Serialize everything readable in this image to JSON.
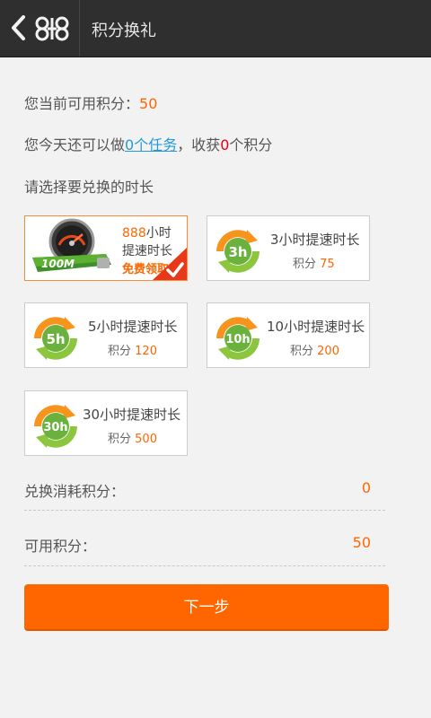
{
  "header": {
    "title": "积分换礼"
  },
  "info": {
    "points_label": "您当前可用积分：",
    "points_value": "50",
    "task_prefix": "您今天还可以做",
    "task_link": "0个任务",
    "task_middle": "，收获",
    "task_count": "0",
    "task_suffix": "个积分",
    "select_prompt": "请选择要兑换的时长"
  },
  "options": [
    {
      "icon": "speedometer-badge-icon",
      "badge": "100M",
      "line1_num": "888",
      "line1_unit": "小时",
      "line2": "提速时长",
      "line3": "免费领取",
      "selected": true
    },
    {
      "icon": "refresh-badge-icon",
      "badge": "3h",
      "title": "3小时提速时长",
      "points_label": "积分",
      "points": "75"
    },
    {
      "icon": "refresh-badge-icon",
      "badge": "5h",
      "title": "5小时提速时长",
      "points_label": "积分",
      "points": "120"
    },
    {
      "icon": "refresh-badge-icon",
      "badge": "10h",
      "title": "10小时提速时长",
      "points_label": "积分",
      "points": "200"
    },
    {
      "icon": "refresh-badge-icon",
      "badge": "30h",
      "title": "30小时提速时长",
      "points_label": "积分",
      "points": "500"
    }
  ],
  "summary": {
    "cost_label": "兑换消耗积分：",
    "cost_value": "0",
    "available_label": "可用积分：",
    "available_value": "50"
  },
  "actions": {
    "next_label": "下一步"
  },
  "colors": {
    "accent": "#ff6600",
    "header_bg": "#2f2f2f",
    "link": "#2299dd",
    "green": "#6ab23d"
  }
}
